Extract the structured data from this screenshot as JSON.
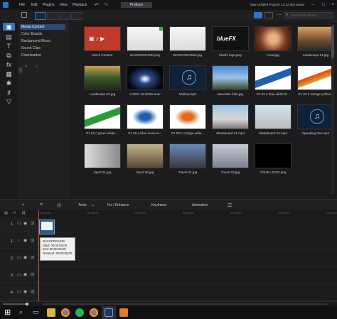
{
  "menu": [
    "File",
    "Edit",
    "Plugins",
    "View",
    "Playback"
  ],
  "produce_label": "Produce",
  "project_title": "New Untitled Project* 12:22 last saved",
  "search": {
    "placeholder": "Search the library"
  },
  "categories": [
    {
      "label": "Media Content",
      "selected": true
    },
    {
      "label": "Color Boards",
      "selected": false
    },
    {
      "label": "Background Music",
      "selected": false
    },
    {
      "label": "Sound Clips",
      "selected": false
    },
    {
      "label": "Downloaded",
      "selected": false
    }
  ],
  "library": [
    {
      "label": "Stock Content",
      "kind": "stock",
      "checked": false
    },
    {
      "label": "BACKGROUND.png",
      "kind": "white",
      "checked": true
    },
    {
      "label": "BACKGROUND.jpg",
      "kind": "white",
      "checked": false
    },
    {
      "label": "bluefx logo.png",
      "kind": "logo",
      "checked": false
    },
    {
      "label": "Food.jpg",
      "kind": "food",
      "checked": false
    },
    {
      "label": "Landscape 01.jpg",
      "kind": "sunset",
      "checked": false
    },
    {
      "label": "Landscape 02.jpg",
      "kind": "forest",
      "checked": false
    },
    {
      "label": "LOGO 16 LENS.mov",
      "kind": "lens",
      "checked": false
    },
    {
      "label": "Mellow.mp3",
      "kind": "music",
      "checked": false
    },
    {
      "label": "Mountain bike.jpg",
      "kind": "bike",
      "checked": false
    },
    {
      "label": "P1 02 a blue white bl...",
      "kind": "ribbon-blue",
      "checked": false
    },
    {
      "label": "P1 02 b orange yellow...",
      "kind": "ribbon-orange",
      "checked": false
    },
    {
      "label": "P1 02 c green white ...",
      "kind": "ribbon-green",
      "checked": false
    },
    {
      "label": "P1 05 a blue move.m...",
      "kind": "splash-blue",
      "checked": false
    },
    {
      "label": "P1 05 b orange yello...",
      "kind": "splash-orange",
      "checked": false
    },
    {
      "label": "Skateboard 01.mp4",
      "kind": "skate",
      "checked": false
    },
    {
      "label": "Skateboard 02.mp4",
      "kind": "skate2",
      "checked": false
    },
    {
      "label": "Speaking Out.mp3",
      "kind": "music",
      "checked": false
    },
    {
      "label": "Sport 01.jpg",
      "kind": "sport",
      "checked": false
    },
    {
      "label": "Sport 02.jpg",
      "kind": "sport2",
      "checked": false
    },
    {
      "label": "Travel 01.jpg",
      "kind": "travel",
      "checked": false
    },
    {
      "label": "Travel 02.jpg",
      "kind": "travel2",
      "checked": false
    },
    {
      "label": "YOUR LOGO.png",
      "kind": "black",
      "checked": false
    }
  ],
  "timeline_toolbar": {
    "tools": "Tools",
    "fix": "Fix / Enhance",
    "keyframe": "Keyframe",
    "animation": "Animation"
  },
  "ruler_ticks": [
    "00:00:00",
    "00:16:20",
    "00:33:10",
    "00:50:00",
    "01:06:20",
    "01:23:12",
    "01:40:00"
  ],
  "tracks": [
    "1.",
    "1.",
    "2.",
    "3.",
    "4."
  ],
  "tooltip": {
    "name": "BACKGROUND",
    "start": "Start: 00;00;00;00",
    "end": "End: 00;00;05;00",
    "duration": "Duration: 00;00;05;00"
  },
  "colors": {
    "accent": "#2f73c9",
    "selected_category": "#2c4a78",
    "playhead": "#d8542a"
  }
}
